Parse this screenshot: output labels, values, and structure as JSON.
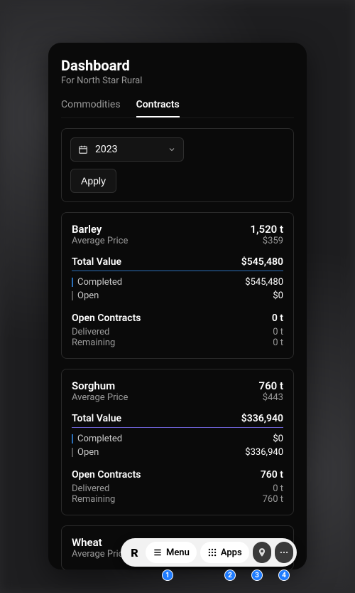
{
  "header": {
    "title": "Dashboard",
    "subtitle": "For North Star Rural"
  },
  "tabs": {
    "commodities": "Commodities",
    "contracts": "Contracts"
  },
  "filter": {
    "year": "2023",
    "apply": "Apply"
  },
  "labels": {
    "avg_price": "Average Price",
    "total_value": "Total Value",
    "completed": "Completed",
    "open": "Open",
    "open_contracts": "Open Contracts",
    "delivered": "Delivered",
    "remaining": "Remaining"
  },
  "cards": [
    {
      "name": "Barley",
      "quantity": "1,520 t",
      "avg_price": "$359",
      "total_value": "$545,480",
      "divider": "blue",
      "completed": "$545,480",
      "open": "$0",
      "open_contracts": "0 t",
      "delivered": "0 t",
      "remaining": "0 t"
    },
    {
      "name": "Sorghum",
      "quantity": "760 t",
      "avg_price": "$443",
      "total_value": "$336,940",
      "divider": "purple",
      "completed": "$0",
      "open": "$336,940",
      "open_contracts": "760 t",
      "delivered": "0 t",
      "remaining": "760 t"
    },
    {
      "name": "Wheat",
      "quantity": "",
      "avg_price": "",
      "total_value": "",
      "divider": "blue",
      "completed": "",
      "open": "",
      "open_contracts": "",
      "delivered": "",
      "remaining": ""
    }
  ],
  "toolbar": {
    "logo": "R",
    "menu": "Menu",
    "apps": "Apps",
    "badges": [
      "1",
      "2",
      "3",
      "4"
    ]
  }
}
